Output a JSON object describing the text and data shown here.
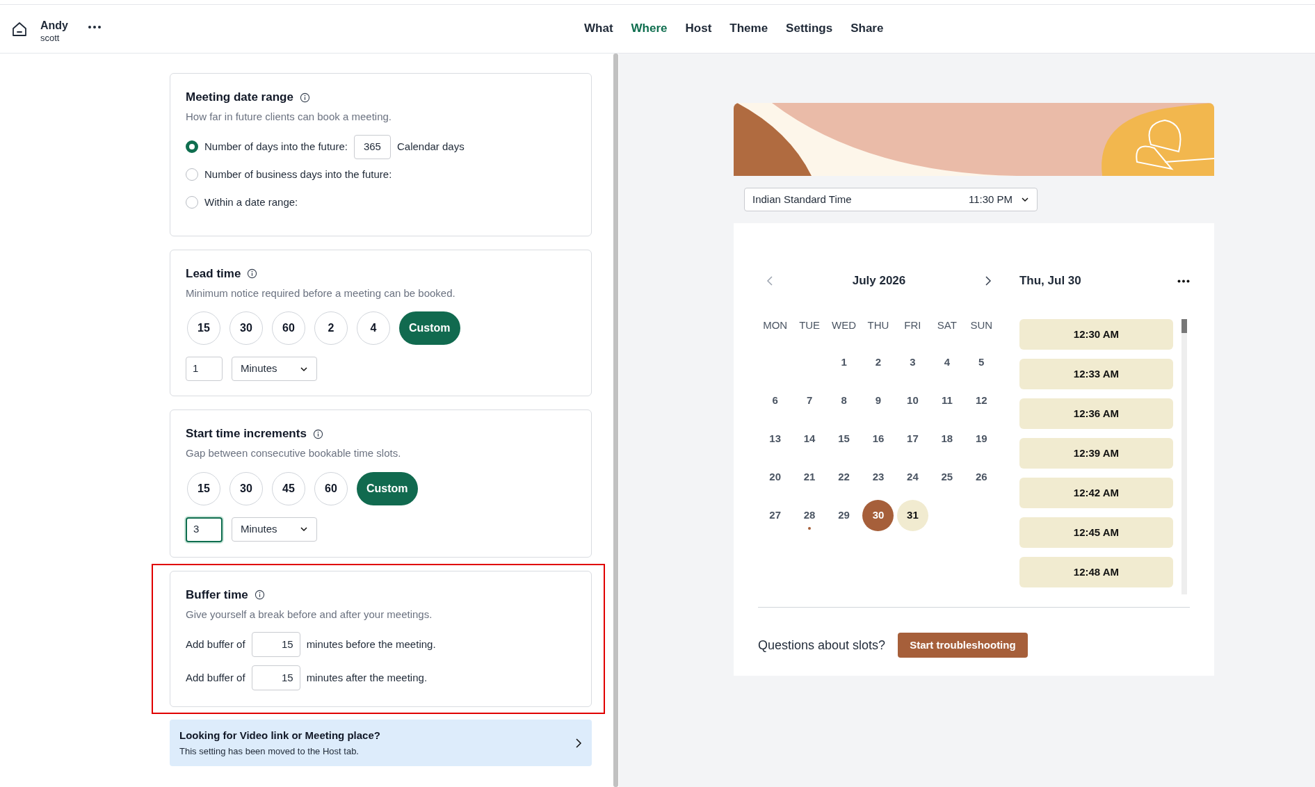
{
  "header": {
    "user": {
      "name": "Andy",
      "subtitle": "scott"
    },
    "tabs": [
      {
        "label": "What",
        "selected": false
      },
      {
        "label": "Where",
        "selected": true
      },
      {
        "label": "Host",
        "selected": false
      },
      {
        "label": "Theme",
        "selected": false
      },
      {
        "label": "Settings",
        "selected": false
      },
      {
        "label": "Share",
        "selected": false
      }
    ]
  },
  "sections": [
    {
      "kind": "radio",
      "title": "Meeting date range",
      "description": "How far in future clients can book a meeting.",
      "options": [
        {
          "label": "Number of days into the future:",
          "selected": true,
          "value": "365",
          "suffix": "Calendar days"
        },
        {
          "label": "Number of business days into the future:",
          "selected": false
        },
        {
          "label": "Within a date range:",
          "selected": false
        }
      ]
    },
    {
      "kind": "chips",
      "title": "Lead time",
      "description": "Minimum notice required before a meeting can be booked.",
      "chips": [
        {
          "label": "15",
          "selected": false
        },
        {
          "label": "30",
          "selected": false
        },
        {
          "label": "60",
          "selected": false
        },
        {
          "label": "2",
          "selected": false
        },
        {
          "label": "4",
          "selected": false
        },
        {
          "label": "Custom",
          "selected": true
        }
      ],
      "amount": "1",
      "focused": false,
      "unit": "Minutes"
    },
    {
      "kind": "chips",
      "title": "Start time increments",
      "description": "Gap between consecutive bookable time slots.",
      "chips": [
        {
          "label": "15",
          "selected": false
        },
        {
          "label": "30",
          "selected": false
        },
        {
          "label": "45",
          "selected": false
        },
        {
          "label": "60",
          "selected": false
        },
        {
          "label": "Custom",
          "selected": true
        }
      ],
      "amount": "3",
      "focused": true,
      "unit": "Minutes"
    },
    {
      "kind": "buffer",
      "title": "Buffer time",
      "description": "Give yourself a break before and after your meetings.",
      "highlighted": true,
      "rows": [
        {
          "prefix": "Add buffer of",
          "value": "15",
          "suffix": "minutes before the meeting."
        },
        {
          "prefix": "Add buffer of",
          "value": "15",
          "suffix": "minutes after the meeting."
        }
      ]
    }
  ],
  "notice": {
    "title": "Looking for Video link or Meeting place?",
    "text": "This setting has been moved to the Host tab."
  },
  "preview": {
    "timezone": {
      "name": "Indian Standard Time",
      "time": "11:30 PM"
    },
    "calendar": {
      "month": "July 2026",
      "weekdays": [
        "MON",
        "TUE",
        "WED",
        "THU",
        "FRI",
        "SAT",
        "SUN"
      ],
      "weeks": [
        {
          "kind": "leading",
          "days": [
            {
              "label": "1",
              "selected": false,
              "available": false,
              "today": false
            },
            {
              "label": "2",
              "selected": false,
              "available": false,
              "today": false
            },
            {
              "label": "3",
              "selected": false,
              "available": false,
              "today": false
            },
            {
              "label": "4",
              "selected": false,
              "available": false,
              "today": false
            },
            {
              "label": "5",
              "selected": false,
              "available": false,
              "today": false
            }
          ]
        },
        {
          "kind": "full",
          "days": [
            {
              "label": "6",
              "selected": false,
              "available": false,
              "today": false
            },
            {
              "label": "7",
              "selected": false,
              "available": false,
              "today": false
            },
            {
              "label": "8",
              "selected": false,
              "available": false,
              "today": false
            },
            {
              "label": "9",
              "selected": false,
              "available": false,
              "today": false
            },
            {
              "label": "10",
              "selected": false,
              "available": false,
              "today": false
            },
            {
              "label": "11",
              "selected": false,
              "available": false,
              "today": false
            },
            {
              "label": "12",
              "selected": false,
              "available": false,
              "today": false
            }
          ]
        },
        {
          "kind": "full",
          "days": [
            {
              "label": "13",
              "selected": false,
              "available": false,
              "today": false
            },
            {
              "label": "14",
              "selected": false,
              "available": false,
              "today": false
            },
            {
              "label": "15",
              "selected": false,
              "available": false,
              "today": false
            },
            {
              "label": "16",
              "selected": false,
              "available": false,
              "today": false
            },
            {
              "label": "17",
              "selected": false,
              "available": false,
              "today": false
            },
            {
              "label": "18",
              "selected": false,
              "available": false,
              "today": false
            },
            {
              "label": "19",
              "selected": false,
              "available": false,
              "today": false
            }
          ]
        },
        {
          "kind": "full",
          "days": [
            {
              "label": "20",
              "selected": false,
              "available": false,
              "today": false
            },
            {
              "label": "21",
              "selected": false,
              "available": false,
              "today": false
            },
            {
              "label": "22",
              "selected": false,
              "available": false,
              "today": false
            },
            {
              "label": "23",
              "selected": false,
              "available": false,
              "today": false
            },
            {
              "label": "24",
              "selected": false,
              "available": false,
              "today": false
            },
            {
              "label": "25",
              "selected": false,
              "available": false,
              "today": false
            },
            {
              "label": "26",
              "selected": false,
              "available": false,
              "today": false
            }
          ]
        },
        {
          "kind": "trailing",
          "days": [
            {
              "label": "27",
              "selected": false,
              "available": false,
              "today": false
            },
            {
              "label": "28",
              "selected": false,
              "available": false,
              "today": true
            },
            {
              "label": "29",
              "selected": false,
              "available": false,
              "today": false
            },
            {
              "label": "30",
              "selected": true,
              "available": true,
              "today": false
            },
            {
              "label": "31",
              "selected": false,
              "available": true,
              "today": false
            }
          ]
        }
      ]
    },
    "selected_date": "Thu, Jul 30",
    "slots": [
      "12:30 AM",
      "12:33 AM",
      "12:36 AM",
      "12:39 AM",
      "12:42 AM",
      "12:45 AM",
      "12:48 AM"
    ],
    "troubleshoot": {
      "question": "Questions about slots?",
      "button": "Start troubleshooting"
    }
  }
}
